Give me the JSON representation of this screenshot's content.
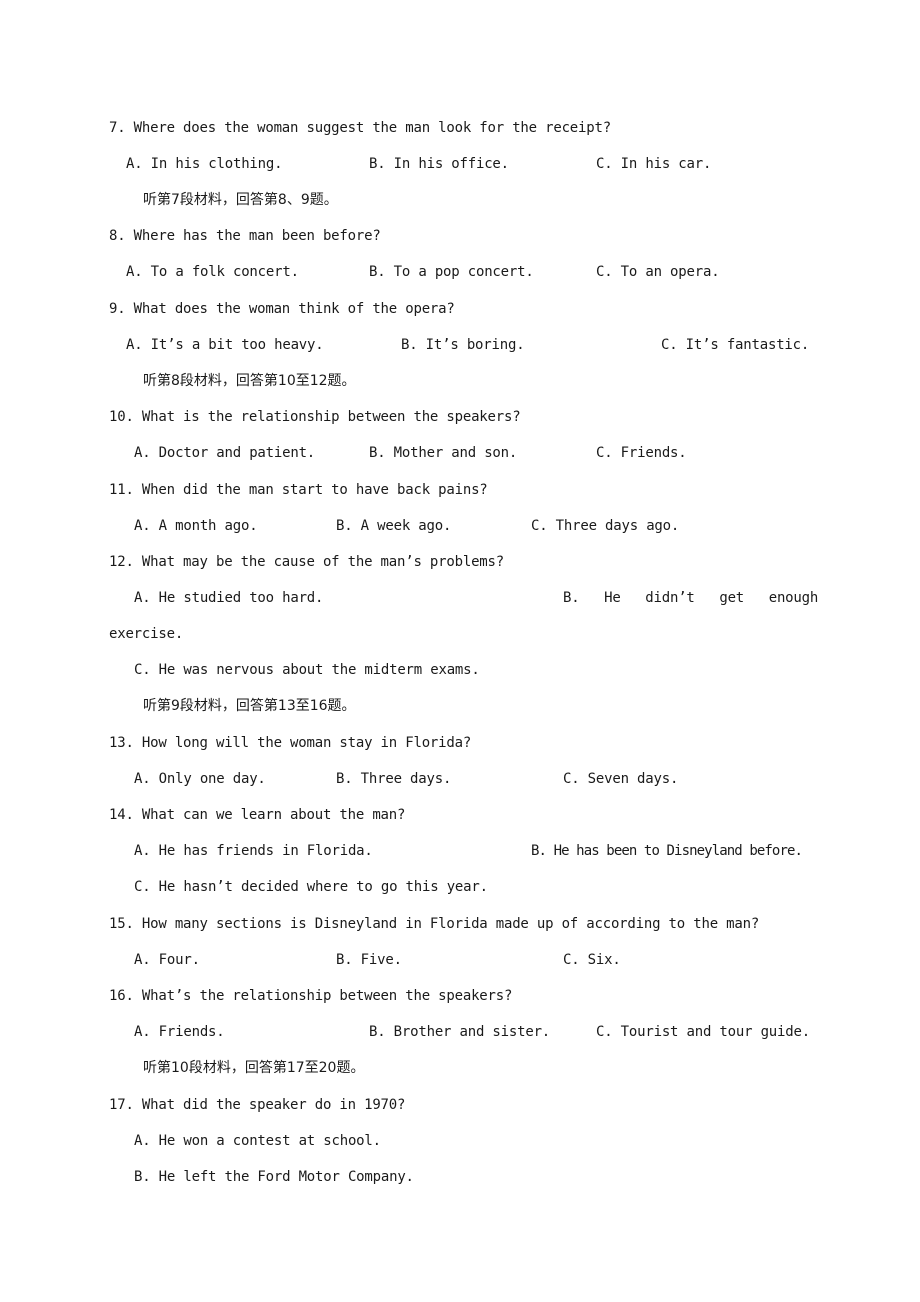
{
  "document": {
    "lines": [
      {
        "type": "question",
        "number": "7.",
        "text": "7. Where does the woman suggest the man look for the receipt?"
      },
      {
        "type": "options",
        "A": "A. In his clothing.",
        "B": "B. In his office.",
        "C": "C. In his car."
      },
      {
        "type": "instruction",
        "text": "听第7段材料，回答第8、9题。"
      },
      {
        "type": "question",
        "text": "8. Where has the man been before?"
      },
      {
        "type": "options",
        "A": "A. To a folk concert.",
        "B": "B. To a pop concert.",
        "C": "C. To an opera."
      },
      {
        "type": "question",
        "text": "9. What does the woman think of the opera?"
      },
      {
        "type": "options",
        "A": "A. It’s a bit too heavy.",
        "B": "B. It’s boring.",
        "C": "C. It’s fantastic."
      },
      {
        "type": "instruction",
        "text": "听第8段材料，回答第10至12题。"
      },
      {
        "type": "question",
        "text": "10. What is the relationship between the speakers?"
      },
      {
        "type": "options",
        "A": "A. Doctor and patient.",
        "B": "B. Mother and son.",
        "C": "C. Friends."
      },
      {
        "type": "question",
        "text": "11. When did the man start to have back pains?"
      },
      {
        "type": "options",
        "A": "A. A month ago.",
        "B": "B. A week ago.",
        "C": "C. Three days ago."
      },
      {
        "type": "question",
        "text": "12. What may be the cause of the man’s problems?"
      },
      {
        "type": "options",
        "A": "A. He studied too hard.",
        "B": "B.   He   didn’t   get   enough",
        "B_cont": "exercise."
      },
      {
        "type": "option_single",
        "C": "C. He was nervous about the midterm exams."
      },
      {
        "type": "instruction",
        "text": "听第9段材料，回答第13至16题。"
      },
      {
        "type": "question",
        "text": "13. How long will the woman stay in Florida?"
      },
      {
        "type": "options",
        "A": "A. Only one day.",
        "B": "B. Three days.",
        "C": "C. Seven days."
      },
      {
        "type": "question",
        "text": "14. What can we learn about the man?"
      },
      {
        "type": "options",
        "A": "A. He has friends in Florida.",
        "B": "B. He has been to Disneyland before."
      },
      {
        "type": "option_single",
        "C": "C. He hasn’t decided where to go this year."
      },
      {
        "type": "question",
        "text": "15. How many sections is Disneyland in Florida made up of according to the man?"
      },
      {
        "type": "options",
        "A": "A. Four.",
        "B": "B. Five.",
        "C": "C. Six."
      },
      {
        "type": "question",
        "text": "16. What’s the relationship between the speakers?"
      },
      {
        "type": "options",
        "A": "A. Friends.",
        "B": "B. Brother and sister.",
        "C": "C. Tourist and tour guide."
      },
      {
        "type": "instruction",
        "text": "听第10段材料，回答第17至20题。"
      },
      {
        "type": "question",
        "text": "17. What did the speaker do in 1970?"
      },
      {
        "type": "option_single",
        "A": "A. He won a contest at school."
      },
      {
        "type": "option_single",
        "B": "B. He left the Ford Motor Company."
      }
    ]
  }
}
